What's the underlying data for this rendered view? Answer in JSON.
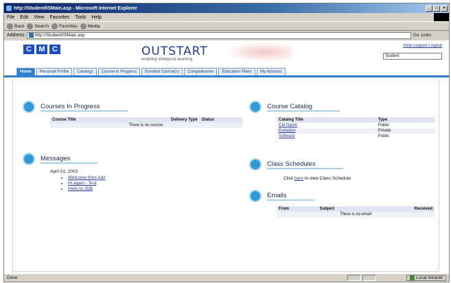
{
  "window": {
    "title": "http://Student/ISMain.asp - Microsoft Internet Explorer"
  },
  "menu": [
    "File",
    "Edit",
    "View",
    "Favorites",
    "Tools",
    "Help"
  ],
  "toolbar": [
    "Back",
    "Search",
    "Favorites",
    "Media"
  ],
  "address": {
    "label": "Address",
    "url": "http://Student/ISMain.asp",
    "go": "Go",
    "links": "Links"
  },
  "header": {
    "logo_letters": [
      "C",
      "M",
      "C"
    ],
    "brand": "OUTSTART",
    "tagline": "enabling enterprise learning",
    "top_links": "Help Logout Logout",
    "user_select": "Student"
  },
  "tabs": [
    "Home",
    "Personal Profile",
    "Catalogs",
    "Course in Progress",
    "Enrolled Course(s)",
    "Competencies",
    "Education Plans",
    "My Advisors"
  ],
  "courses_in_progress": {
    "title": "Courses In Progress",
    "columns": [
      "Course Title",
      "Delivery Type",
      "Status"
    ],
    "empty": "There is no course."
  },
  "messages": {
    "title": "Messages",
    "date": "April 01, 2003",
    "items": [
      "Welcome from Adil",
      "Hi again - Test",
      "Hello to JDB"
    ]
  },
  "course_catalog": {
    "title": "Course Catalog",
    "columns": [
      "Catalog Title",
      "Type"
    ],
    "rows": [
      [
        "Cat Name",
        "Public"
      ],
      [
        "Evolution",
        "Private"
      ],
      [
        "Software",
        "Public"
      ]
    ]
  },
  "class_schedules": {
    "title": "Class Schedules",
    "text_before": "Click",
    "link": "here",
    "text_after": "to view Class Schedule"
  },
  "emails": {
    "title": "Emails",
    "columns": [
      "From",
      "Subject",
      "Received"
    ],
    "empty": "There is no email"
  },
  "status": {
    "left": "Done",
    "zone": "Local intranet"
  },
  "colors": {
    "tab_active": "#2f7fd0",
    "brand": "#1f3b8a",
    "icon": "#2f9ad6"
  }
}
